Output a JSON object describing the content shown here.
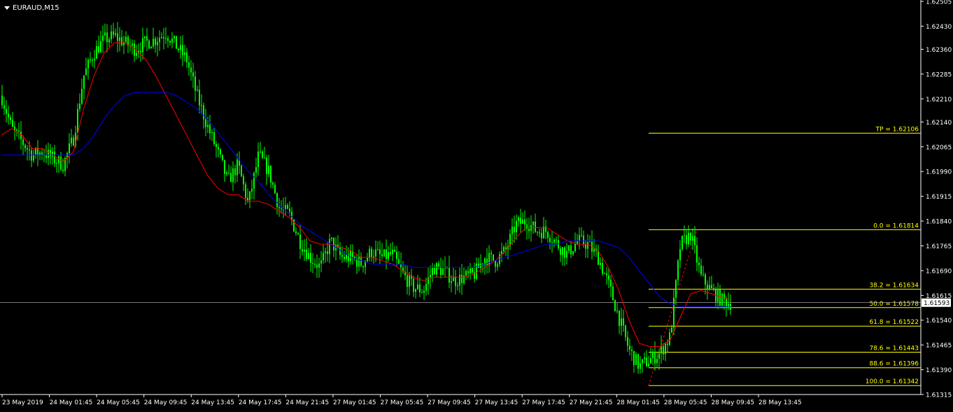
{
  "window": {
    "symbol_label": "EURAUD,M15"
  },
  "colors": {
    "background": "#000000",
    "candles": "#00ff00",
    "ma_fast": "#ff0000",
    "ma_slow": "#0000ff",
    "fibo": "#ffff00",
    "price_line": "#c0c0c0",
    "axis": "#ffffff"
  },
  "chart_data": {
    "type": "line",
    "title": "EURAUD,M15",
    "ylim": [
      1.61315,
      1.62505
    ],
    "y_ticks": [
      "1.62505",
      "1.62430",
      "1.62360",
      "1.62285",
      "1.62210",
      "1.62140",
      "1.62065",
      "1.61990",
      "1.61915",
      "1.61840",
      "1.61765",
      "1.61690",
      "1.61615",
      "1.61540",
      "1.61465",
      "1.61390",
      "1.61315"
    ],
    "x_ticks": [
      "23 May 2019",
      "24 May 01:45",
      "24 May 05:45",
      "24 May 09:45",
      "24 May 13:45",
      "24 May 17:45",
      "24 May 21:45",
      "27 May 01:45",
      "27 May 05:45",
      "27 May 09:45",
      "27 May 13:45",
      "27 May 17:45",
      "27 May 21:45",
      "28 May 01:45",
      "28 May 05:45",
      "28 May 09:45",
      "28 May 13:45"
    ],
    "current_price": "1.61593",
    "close_anchors": [
      1.6222,
      1.6212,
      1.6208,
      1.6204,
      1.6205,
      1.6203,
      1.6201,
      1.6209,
      1.6228,
      1.6235,
      1.6239,
      1.624,
      1.6238,
      1.6236,
      1.6238,
      1.6239,
      1.6241,
      1.6237,
      1.6233,
      1.6222,
      1.6213,
      1.6205,
      1.6196,
      1.6201,
      1.6189,
      1.6204,
      1.6199,
      1.6188,
      1.6186,
      1.6178,
      1.6173,
      1.617,
      1.6178,
      1.6173,
      1.6173,
      1.6171,
      1.6175,
      1.6173,
      1.6174,
      1.6168,
      1.6164,
      1.6163,
      1.617,
      1.6169,
      1.6166,
      1.6167,
      1.6168,
      1.6173,
      1.6172,
      1.6175,
      1.6183,
      1.6184,
      1.6181,
      1.6181,
      1.6177,
      1.6174,
      1.6178,
      1.6177,
      1.6173,
      1.6165,
      1.6155,
      1.6145,
      1.614,
      1.6142,
      1.6144,
      1.6149,
      1.6177,
      1.618,
      1.6167,
      1.6163,
      1.616,
      1.6159
    ],
    "series": [
      {
        "values": [
          1.621,
          1.6212,
          1.621,
          1.6206,
          1.6206,
          1.6204,
          1.6202,
          1.6205,
          1.6218,
          1.6228,
          1.6235,
          1.6238,
          1.6238,
          1.6236,
          1.6233,
          1.6228,
          1.6222,
          1.6216,
          1.621,
          1.6204,
          1.6198,
          1.6194,
          1.6192,
          1.6192,
          1.619,
          1.619,
          1.6189,
          1.6187,
          1.6185,
          1.6182,
          1.6178,
          1.6177,
          1.6177,
          1.6176,
          1.6175,
          1.6173,
          1.6173,
          1.6172,
          1.6171,
          1.6169,
          1.6167,
          1.6166,
          1.6167,
          1.6167,
          1.6167,
          1.6167,
          1.6168,
          1.617,
          1.6172,
          1.6175,
          1.6179,
          1.6182,
          1.6182,
          1.6182,
          1.618,
          1.6178,
          1.6177,
          1.6177,
          1.6175,
          1.617,
          1.6163,
          1.6154,
          1.6147,
          1.6146,
          1.6146,
          1.6148,
          1.6155,
          1.6162,
          1.6163,
          1.6162,
          1.6161,
          1.616
        ]
      },
      {
        "values": [
          1.6204,
          1.6204,
          1.6204,
          1.6204,
          1.6204,
          1.6204,
          1.6204,
          1.6204,
          1.6206,
          1.621,
          1.6215,
          1.6219,
          1.6222,
          1.6223,
          1.6223,
          1.6223,
          1.6223,
          1.6222,
          1.622,
          1.6218,
          1.6215,
          1.6211,
          1.6207,
          1.6203,
          1.6199,
          1.6196,
          1.6192,
          1.6189,
          1.6186,
          1.6183,
          1.6181,
          1.6179,
          1.6177,
          1.6175,
          1.6173,
          1.6172,
          1.6171,
          1.6171,
          1.6171,
          1.6171,
          1.617,
          1.617,
          1.617,
          1.617,
          1.617,
          1.617,
          1.617,
          1.6171,
          1.6172,
          1.6173,
          1.6174,
          1.6175,
          1.6176,
          1.6177,
          1.6177,
          1.6178,
          1.6178,
          1.6178,
          1.6178,
          1.6177,
          1.6176,
          1.6173,
          1.6169,
          1.6165,
          1.6161,
          1.6159,
          1.6158,
          1.6158,
          1.6158,
          1.6158,
          1.6158,
          1.6158
        ]
      }
    ],
    "fibo_levels": [
      {
        "label": "TP = 1.62106",
        "price": 1.62106
      },
      {
        "label": "0.0 = 1.61814",
        "price": 1.61814
      },
      {
        "label": "38.2 = 1.61634",
        "price": 1.61634
      },
      {
        "label": "50.0 = 1.61578",
        "price": 1.61578
      },
      {
        "label": "61.8 = 1.61522",
        "price": 1.61522
      },
      {
        "label": "78.6 = 1.61443",
        "price": 1.61443
      },
      {
        "label": "88.6 = 1.61396",
        "price": 1.61396
      },
      {
        "label": "100.0 = 1.61342",
        "price": 1.61342
      }
    ]
  }
}
